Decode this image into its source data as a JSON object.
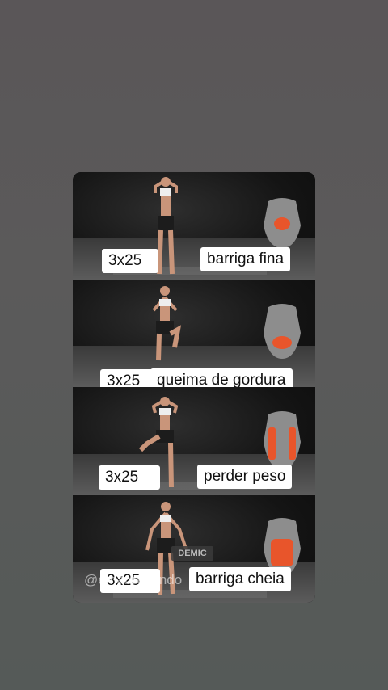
{
  "panels": [
    {
      "reps": "3x25",
      "goal": "barriga fina"
    },
    {
      "reps": "3x25",
      "goal": "queima de gordura"
    },
    {
      "reps": "3x25",
      "goal": "perder peso"
    },
    {
      "reps": "3x25",
      "goal": "barriga cheia"
    }
  ],
  "watermark": {
    "handle": "@emagrecendo",
    "badge": "DEMIC"
  },
  "colors": {
    "muscle_highlight": "#e8552b",
    "label_bg": "#ffffff"
  }
}
